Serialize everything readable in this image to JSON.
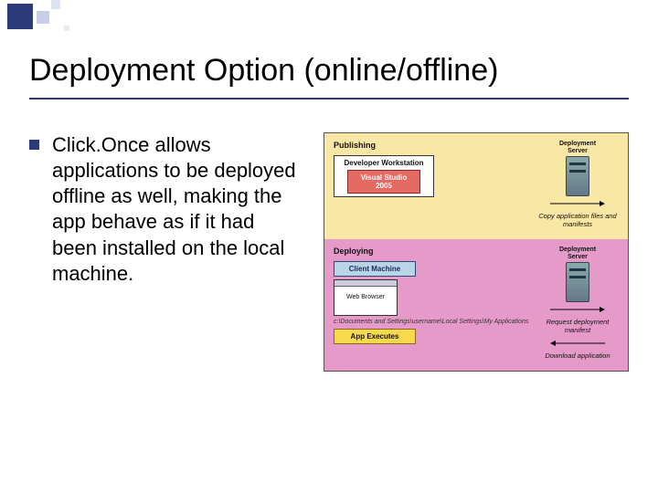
{
  "title": "Deployment Option (online/offline)",
  "body": "Click.Once allows applications to be deployed offline as well, making the app behave as if it had been installed on the local machine.",
  "diagram": {
    "publishing": {
      "heading": "Publishing",
      "workstation_label": "Developer Workstation",
      "vs_label": "Visual Studio 2005",
      "server_label": "Deployment Server",
      "arrow_text": "Copy application files and manifests"
    },
    "deploying": {
      "heading": "Deploying",
      "client_label": "Client Machine",
      "browser_label": "Web Browser",
      "path_text": "c:\\Documents and Settings\\username\\Local Settings\\My Applications",
      "exec_label": "App Executes",
      "server_label": "Deployment Server",
      "arrow1_text": "Request deployment manifest",
      "arrow2_text": "Download application"
    }
  }
}
